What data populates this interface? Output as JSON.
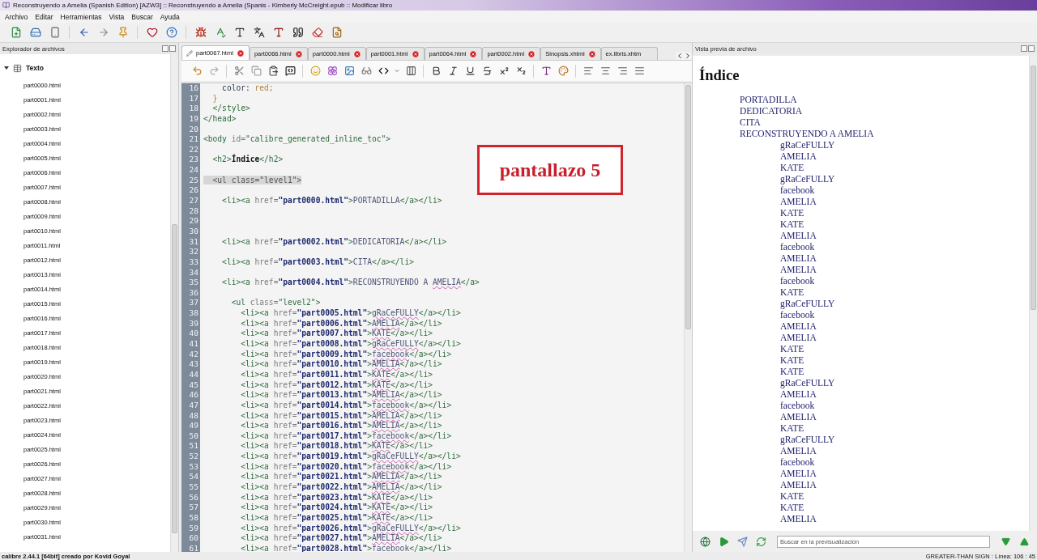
{
  "window": {
    "title": "Reconstruyendo a Amelia (Spanish Edition) [AZW3] :: Reconstruyendo a Amelia (Spanis - Kimberly McCreight.epub :: Modificar libro"
  },
  "menu": [
    "Archivo",
    "Editar",
    "Herramientas",
    "Vista",
    "Buscar",
    "Ayuda"
  ],
  "file_browser": {
    "title": "Explorador de archivos",
    "tree": [
      {
        "label": "Texto",
        "expanded": true,
        "children": [
          {
            "label": "part0000.html"
          },
          {
            "label": "part0001.html"
          },
          {
            "label": "part0002.html"
          },
          {
            "label": "part0003.html"
          },
          {
            "label": "part0004.html"
          },
          {
            "label": "part0005.html"
          },
          {
            "label": "part0006.html"
          },
          {
            "label": "part0007.html"
          },
          {
            "label": "part0008.html"
          },
          {
            "label": "part0009.html"
          },
          {
            "label": "part0010.html"
          },
          {
            "label": "part0011.html"
          },
          {
            "label": "part0012.html"
          },
          {
            "label": "part0013.html"
          },
          {
            "label": "part0014.html"
          },
          {
            "label": "part0015.html"
          },
          {
            "label": "part0016.html"
          },
          {
            "label": "part0017.html"
          },
          {
            "label": "part0018.html"
          },
          {
            "label": "part0019.html"
          },
          {
            "label": "part0020.html"
          },
          {
            "label": "part0021.html"
          },
          {
            "label": "part0022.html"
          },
          {
            "label": "part0023.html"
          },
          {
            "label": "part0024.html"
          },
          {
            "label": "part0025.html"
          },
          {
            "label": "part0026.html"
          },
          {
            "label": "part0027.html"
          },
          {
            "label": "part0028.html"
          },
          {
            "label": "part0029.html"
          },
          {
            "label": "part0030.html"
          },
          {
            "label": "part0031.html"
          }
        ]
      }
    ]
  },
  "editor": {
    "tabs": [
      {
        "label": "part0067.html",
        "selected": true,
        "modified": true,
        "closable": true
      },
      {
        "label": "part0066.html",
        "selected": false,
        "modified": false,
        "closable": true
      },
      {
        "label": "part0000.html",
        "selected": false,
        "modified": false,
        "closable": true
      },
      {
        "label": "part0001.html",
        "selected": false,
        "modified": false,
        "closable": true
      },
      {
        "label": "part0064.html",
        "selected": false,
        "modified": false,
        "closable": true
      },
      {
        "label": "part0002.html",
        "selected": false,
        "modified": false,
        "closable": true
      },
      {
        "label": "Sinopsis.xhtml",
        "selected": false,
        "modified": false,
        "closable": true
      },
      {
        "label": "ex.libris.xhtm",
        "selected": false,
        "modified": false,
        "closable": false
      }
    ],
    "lines": [
      {
        "n": "16",
        "seg": [
          {
            "kind": "css",
            "text": "    color: "
          },
          {
            "kind": "val",
            "text": "red;"
          }
        ]
      },
      {
        "n": "17",
        "seg": [
          {
            "kind": "val",
            "text": "  }"
          }
        ]
      },
      {
        "n": "18",
        "seg": [
          {
            "kind": "tag",
            "text": "  </style>"
          }
        ]
      },
      {
        "n": "19",
        "seg": [
          {
            "kind": "tag",
            "text": "</head>"
          }
        ]
      },
      {
        "n": "20"
      },
      {
        "n": "21",
        "seg": [
          {
            "kind": "tag",
            "text": "<body "
          },
          {
            "kind": "attr",
            "text": "id="
          },
          {
            "kind": "tag",
            "text": "\"calibre_generated_inline_toc\">"
          }
        ]
      },
      {
        "n": "22"
      },
      {
        "n": "23",
        "seg": [
          {
            "kind": "tag",
            "text": "  <h2>"
          },
          {
            "kind": "bold",
            "text": "Índice"
          },
          {
            "kind": "tag",
            "text": "</h2>"
          }
        ]
      },
      {
        "n": "24"
      },
      {
        "n": "25",
        "seg": [
          {
            "kind": "match",
            "text": "  <ul class=\"level1\">"
          }
        ]
      },
      {
        "n": "26"
      },
      {
        "n": "27",
        "seg": [
          {
            "kind": "tag",
            "text": "    <li><a "
          },
          {
            "kind": "attr",
            "text": "href="
          },
          {
            "kind": "str",
            "text": "\"part0000.html\""
          },
          {
            "kind": "tag",
            "text": ">"
          },
          {
            "kind": "text",
            "text": "PORTADILLA"
          },
          {
            "kind": "tag",
            "text": "</a></li>"
          }
        ]
      },
      {
        "n": "28"
      },
      {
        "n": "29"
      },
      {
        "n": "30"
      },
      {
        "n": "31",
        "seg": [
          {
            "kind": "tag",
            "text": "    <li><a "
          },
          {
            "kind": "attr",
            "text": "href="
          },
          {
            "kind": "str",
            "text": "\"part0002.html\""
          },
          {
            "kind": "tag",
            "text": ">"
          },
          {
            "kind": "text",
            "text": "DEDICATORIA"
          },
          {
            "kind": "tag",
            "text": "</a></li>"
          }
        ]
      },
      {
        "n": "32"
      },
      {
        "n": "33",
        "seg": [
          {
            "kind": "tag",
            "text": "    <li><a "
          },
          {
            "kind": "attr",
            "text": "href="
          },
          {
            "kind": "str",
            "text": "\"part0003.html\""
          },
          {
            "kind": "tag",
            "text": ">"
          },
          {
            "kind": "text",
            "text": "CITA"
          },
          {
            "kind": "tag",
            "text": "</a></li>"
          }
        ]
      },
      {
        "n": "34"
      },
      {
        "n": "35",
        "seg": [
          {
            "kind": "tag",
            "text": "    <li><a "
          },
          {
            "kind": "attr",
            "text": "href="
          },
          {
            "kind": "str",
            "text": "\"part0004.html\""
          },
          {
            "kind": "tag",
            "text": ">"
          },
          {
            "kind": "text",
            "text": "RECONSTRUYENDO A "
          },
          {
            "kind": "spell",
            "text": "AMELIA"
          },
          {
            "kind": "tag",
            "text": "</a>"
          }
        ]
      },
      {
        "n": "36"
      },
      {
        "n": "37",
        "seg": [
          {
            "kind": "tag",
            "text": "      <ul "
          },
          {
            "kind": "attr",
            "text": "class="
          },
          {
            "kind": "tag",
            "text": "\"level2\">"
          }
        ]
      },
      {
        "n": "38",
        "seg": [
          {
            "kind": "tag",
            "text": "        <li><a "
          },
          {
            "kind": "attr",
            "text": "href="
          },
          {
            "kind": "str",
            "text": "\"part0005.html\""
          },
          {
            "kind": "tag",
            "text": ">"
          },
          {
            "kind": "spell",
            "text": "gRaCeFULLY"
          },
          {
            "kind": "tag",
            "text": "</a></li>"
          }
        ]
      },
      {
        "n": "39",
        "seg": [
          {
            "kind": "tag",
            "text": "        <li><a "
          },
          {
            "kind": "attr",
            "text": "href="
          },
          {
            "kind": "str",
            "text": "\"part0006.html\""
          },
          {
            "kind": "tag",
            "text": ">"
          },
          {
            "kind": "spell",
            "text": "AMELIA"
          },
          {
            "kind": "tag",
            "text": "</a></li>"
          }
        ]
      },
      {
        "n": "40",
        "seg": [
          {
            "kind": "tag",
            "text": "        <li><a "
          },
          {
            "kind": "attr",
            "text": "href="
          },
          {
            "kind": "str",
            "text": "\"part0007.html\""
          },
          {
            "kind": "tag",
            "text": ">"
          },
          {
            "kind": "spell",
            "text": "KATE"
          },
          {
            "kind": "tag",
            "text": "</a></li>"
          }
        ]
      },
      {
        "n": "41",
        "seg": [
          {
            "kind": "tag",
            "text": "        <li><a "
          },
          {
            "kind": "attr",
            "text": "href="
          },
          {
            "kind": "str",
            "text": "\"part0008.html\""
          },
          {
            "kind": "tag",
            "text": ">"
          },
          {
            "kind": "spell",
            "text": "gRaCeFULLY"
          },
          {
            "kind": "tag",
            "text": "</a></li>"
          }
        ]
      },
      {
        "n": "42",
        "seg": [
          {
            "kind": "tag",
            "text": "        <li><a "
          },
          {
            "kind": "attr",
            "text": "href="
          },
          {
            "kind": "str",
            "text": "\"part0009.html\""
          },
          {
            "kind": "tag",
            "text": ">"
          },
          {
            "kind": "spell",
            "text": "facebook"
          },
          {
            "kind": "tag",
            "text": "</a></li>"
          }
        ]
      },
      {
        "n": "43",
        "seg": [
          {
            "kind": "tag",
            "text": "        <li><a "
          },
          {
            "kind": "attr",
            "text": "href="
          },
          {
            "kind": "str",
            "text": "\"part0010.html\""
          },
          {
            "kind": "tag",
            "text": ">"
          },
          {
            "kind": "spell",
            "text": "AMELIA"
          },
          {
            "kind": "tag",
            "text": "</a></li>"
          }
        ]
      },
      {
        "n": "44",
        "seg": [
          {
            "kind": "tag",
            "text": "        <li><a "
          },
          {
            "kind": "attr",
            "text": "href="
          },
          {
            "kind": "str",
            "text": "\"part0011.html\""
          },
          {
            "kind": "tag",
            "text": ">"
          },
          {
            "kind": "spell",
            "text": "KATE"
          },
          {
            "kind": "tag",
            "text": "</a></li>"
          }
        ]
      },
      {
        "n": "45",
        "seg": [
          {
            "kind": "tag",
            "text": "        <li><a "
          },
          {
            "kind": "attr",
            "text": "href="
          },
          {
            "kind": "str",
            "text": "\"part0012.html\""
          },
          {
            "kind": "tag",
            "text": ">"
          },
          {
            "kind": "spell",
            "text": "KATE"
          },
          {
            "kind": "tag",
            "text": "</a></li>"
          }
        ]
      },
      {
        "n": "46",
        "seg": [
          {
            "kind": "tag",
            "text": "        <li><a "
          },
          {
            "kind": "attr",
            "text": "href="
          },
          {
            "kind": "str",
            "text": "\"part0013.html\""
          },
          {
            "kind": "tag",
            "text": ">"
          },
          {
            "kind": "spell",
            "text": "AMELIA"
          },
          {
            "kind": "tag",
            "text": "</a></li>"
          }
        ]
      },
      {
        "n": "47",
        "seg": [
          {
            "kind": "tag",
            "text": "        <li><a "
          },
          {
            "kind": "attr",
            "text": "href="
          },
          {
            "kind": "str",
            "text": "\"part0014.html\""
          },
          {
            "kind": "tag",
            "text": ">"
          },
          {
            "kind": "spell",
            "text": "facebook"
          },
          {
            "kind": "tag",
            "text": "</a></li>"
          }
        ]
      },
      {
        "n": "48",
        "seg": [
          {
            "kind": "tag",
            "text": "        <li><a "
          },
          {
            "kind": "attr",
            "text": "href="
          },
          {
            "kind": "str",
            "text": "\"part0015.html\""
          },
          {
            "kind": "tag",
            "text": ">"
          },
          {
            "kind": "spell",
            "text": "AMELIA"
          },
          {
            "kind": "tag",
            "text": "</a></li>"
          }
        ]
      },
      {
        "n": "49",
        "seg": [
          {
            "kind": "tag",
            "text": "        <li><a "
          },
          {
            "kind": "attr",
            "text": "href="
          },
          {
            "kind": "str",
            "text": "\"part0016.html\""
          },
          {
            "kind": "tag",
            "text": ">"
          },
          {
            "kind": "spell",
            "text": "AMELIA"
          },
          {
            "kind": "tag",
            "text": "</a></li>"
          }
        ]
      },
      {
        "n": "50",
        "seg": [
          {
            "kind": "tag",
            "text": "        <li><a "
          },
          {
            "kind": "attr",
            "text": "href="
          },
          {
            "kind": "str",
            "text": "\"part0017.html\""
          },
          {
            "kind": "tag",
            "text": ">"
          },
          {
            "kind": "spell",
            "text": "facebook"
          },
          {
            "kind": "tag",
            "text": "</a></li>"
          }
        ]
      },
      {
        "n": "51",
        "seg": [
          {
            "kind": "tag",
            "text": "        <li><a "
          },
          {
            "kind": "attr",
            "text": "href="
          },
          {
            "kind": "str",
            "text": "\"part0018.html\""
          },
          {
            "kind": "tag",
            "text": ">"
          },
          {
            "kind": "spell",
            "text": "KATE"
          },
          {
            "kind": "tag",
            "text": "</a></li>"
          }
        ]
      },
      {
        "n": "52",
        "seg": [
          {
            "kind": "tag",
            "text": "        <li><a "
          },
          {
            "kind": "attr",
            "text": "href="
          },
          {
            "kind": "str",
            "text": "\"part0019.html\""
          },
          {
            "kind": "tag",
            "text": ">"
          },
          {
            "kind": "spell",
            "text": "gRaCeFULLY"
          },
          {
            "kind": "tag",
            "text": "</a></li>"
          }
        ]
      },
      {
        "n": "53",
        "seg": [
          {
            "kind": "tag",
            "text": "        <li><a "
          },
          {
            "kind": "attr",
            "text": "href="
          },
          {
            "kind": "str",
            "text": "\"part0020.html\""
          },
          {
            "kind": "tag",
            "text": ">"
          },
          {
            "kind": "spell",
            "text": "facebook"
          },
          {
            "kind": "tag",
            "text": "</a></li>"
          }
        ]
      },
      {
        "n": "54",
        "seg": [
          {
            "kind": "tag",
            "text": "        <li><a "
          },
          {
            "kind": "attr",
            "text": "href="
          },
          {
            "kind": "str",
            "text": "\"part0021.html\""
          },
          {
            "kind": "tag",
            "text": ">"
          },
          {
            "kind": "spell",
            "text": "AMELIA"
          },
          {
            "kind": "tag",
            "text": "</a></li>"
          }
        ]
      },
      {
        "n": "55",
        "seg": [
          {
            "kind": "tag",
            "text": "        <li><a "
          },
          {
            "kind": "attr",
            "text": "href="
          },
          {
            "kind": "str",
            "text": "\"part0022.html\""
          },
          {
            "kind": "tag",
            "text": ">"
          },
          {
            "kind": "spell",
            "text": "AMELIA"
          },
          {
            "kind": "tag",
            "text": "</a></li>"
          }
        ]
      },
      {
        "n": "56",
        "seg": [
          {
            "kind": "tag",
            "text": "        <li><a "
          },
          {
            "kind": "attr",
            "text": "href="
          },
          {
            "kind": "str",
            "text": "\"part0023.html\""
          },
          {
            "kind": "tag",
            "text": ">"
          },
          {
            "kind": "spell",
            "text": "KATE"
          },
          {
            "kind": "tag",
            "text": "</a></li>"
          }
        ]
      },
      {
        "n": "57",
        "seg": [
          {
            "kind": "tag",
            "text": "        <li><a "
          },
          {
            "kind": "attr",
            "text": "href="
          },
          {
            "kind": "str",
            "text": "\"part0024.html\""
          },
          {
            "kind": "tag",
            "text": ">"
          },
          {
            "kind": "spell",
            "text": "KATE"
          },
          {
            "kind": "tag",
            "text": "</a></li>"
          }
        ]
      },
      {
        "n": "58",
        "seg": [
          {
            "kind": "tag",
            "text": "        <li><a "
          },
          {
            "kind": "attr",
            "text": "href="
          },
          {
            "kind": "str",
            "text": "\"part0025.html\""
          },
          {
            "kind": "tag",
            "text": ">"
          },
          {
            "kind": "spell",
            "text": "KATE"
          },
          {
            "kind": "tag",
            "text": "</a></li>"
          }
        ]
      },
      {
        "n": "59",
        "seg": [
          {
            "kind": "tag",
            "text": "        <li><a "
          },
          {
            "kind": "attr",
            "text": "href="
          },
          {
            "kind": "str",
            "text": "\"part0026.html\""
          },
          {
            "kind": "tag",
            "text": ">"
          },
          {
            "kind": "spell",
            "text": "gRaCeFULLY"
          },
          {
            "kind": "tag",
            "text": "</a></li>"
          }
        ]
      },
      {
        "n": "60",
        "seg": [
          {
            "kind": "tag",
            "text": "        <li><a "
          },
          {
            "kind": "attr",
            "text": "href="
          },
          {
            "kind": "str",
            "text": "\"part0027.html\""
          },
          {
            "kind": "tag",
            "text": ">"
          },
          {
            "kind": "spell",
            "text": "AMELIA"
          },
          {
            "kind": "tag",
            "text": "</a></li>"
          }
        ]
      },
      {
        "n": "61",
        "seg": [
          {
            "kind": "tag",
            "text": "        <li><a "
          },
          {
            "kind": "attr",
            "text": "href="
          },
          {
            "kind": "str",
            "text": "\"part0028.html\""
          },
          {
            "kind": "tag",
            "text": ">"
          },
          {
            "kind": "spell",
            "text": "facebook"
          },
          {
            "kind": "tag",
            "text": "</a></li>"
          }
        ]
      }
    ],
    "annotation": "pantallazo 5"
  },
  "preview": {
    "title": "Vista previa de archivo",
    "heading": "Índice",
    "items": [
      {
        "label": "PORTADILLA"
      },
      {
        "label": "DEDICATORIA"
      },
      {
        "label": "CITA"
      },
      {
        "label": "RECONSTRUYENDO A AMELIA",
        "children": [
          {
            "label": "gRaCeFULLY"
          },
          {
            "label": "AMELIA"
          },
          {
            "label": "KATE"
          },
          {
            "label": "gRaCeFULLY"
          },
          {
            "label": "facebook"
          },
          {
            "label": "AMELIA"
          },
          {
            "label": "KATE"
          },
          {
            "label": "KATE"
          },
          {
            "label": "AMELIA"
          },
          {
            "label": "facebook"
          },
          {
            "label": "AMELIA"
          },
          {
            "label": "AMELIA"
          },
          {
            "label": "facebook"
          },
          {
            "label": "KATE"
          },
          {
            "label": "gRaCeFULLY"
          },
          {
            "label": "facebook"
          },
          {
            "label": "AMELIA"
          },
          {
            "label": "AMELIA"
          },
          {
            "label": "KATE"
          },
          {
            "label": "KATE"
          },
          {
            "label": "KATE"
          },
          {
            "label": "gRaCeFULLY"
          },
          {
            "label": "AMELIA"
          },
          {
            "label": "facebook"
          },
          {
            "label": "AMELIA"
          },
          {
            "label": "KATE"
          },
          {
            "label": "gRaCeFULLY"
          },
          {
            "label": "AMELIA"
          },
          {
            "label": "facebook"
          },
          {
            "label": "AMELIA"
          },
          {
            "label": "AMELIA"
          },
          {
            "label": "KATE"
          },
          {
            "label": "KATE"
          },
          {
            "label": "AMELIA"
          }
        ]
      }
    ],
    "search": {
      "placeholder": "Buscar en la previsualización"
    }
  },
  "status_bar": {
    "left": "calibre 2.44.1 [64bit] creado por Kovid Goyal",
    "right": "GREATER-THAN SIGN : Línea: 106 : 45"
  }
}
